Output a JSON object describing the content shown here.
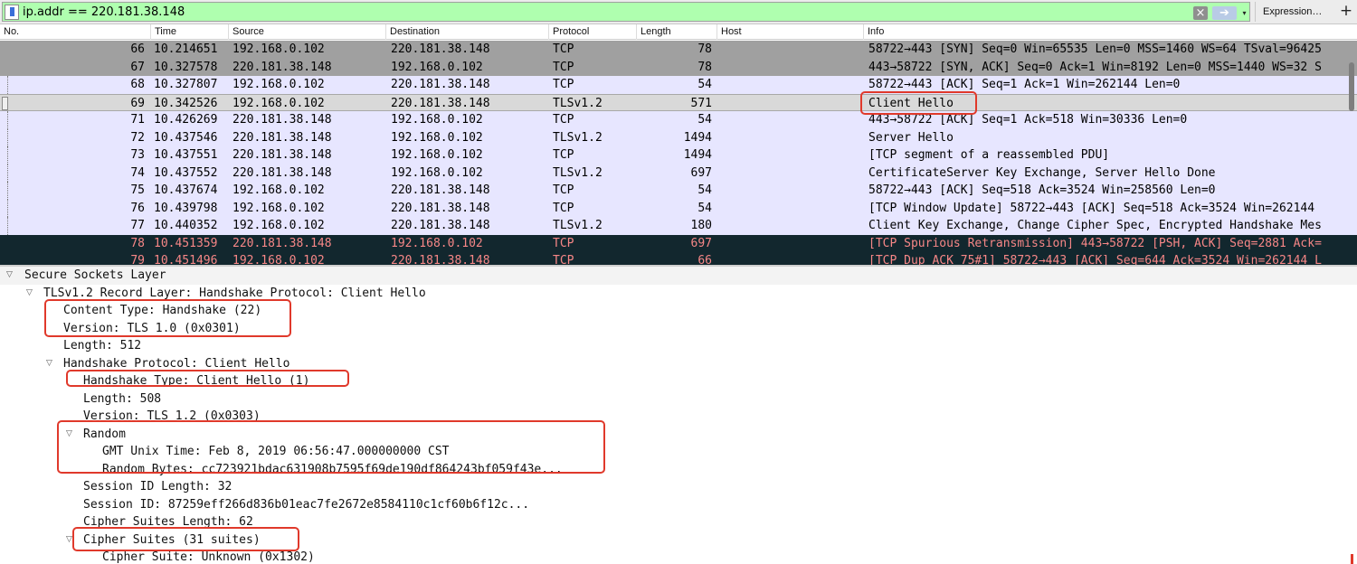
{
  "filter": {
    "value": "ip.addr == 220.181.38.148",
    "clear_icon": "×",
    "apply_icon": "➔",
    "dropdown_icon": "▾",
    "expression_label": "Expression…",
    "plus_label": "+"
  },
  "columns": [
    "No.",
    "Time",
    "Source",
    "Destination",
    "Protocol",
    "Length",
    "Host",
    "Info"
  ],
  "packets": [
    {
      "no": "66",
      "time": "10.214651",
      "src": "192.168.0.102",
      "dst": "220.181.38.148",
      "proto": "TCP",
      "len": "78",
      "info": "58722→443 [SYN] Seq=0 Win=65535 Len=0 MSS=1460 WS=64 TSval=96425"
    },
    {
      "no": "67",
      "time": "10.327578",
      "src": "220.181.38.148",
      "dst": "192.168.0.102",
      "proto": "TCP",
      "len": "78",
      "info": "443→58722 [SYN, ACK] Seq=0 Ack=1 Win=8192 Len=0 MSS=1440 WS=32 S"
    },
    {
      "no": "68",
      "time": "10.327807",
      "src": "192.168.0.102",
      "dst": "220.181.38.148",
      "proto": "TCP",
      "len": "54",
      "info": "58722→443 [ACK] Seq=1 Ack=1 Win=262144 Len=0"
    },
    {
      "no": "69",
      "time": "10.342526",
      "src": "192.168.0.102",
      "dst": "220.181.38.148",
      "proto": "TLSv1.2",
      "len": "571",
      "info": "Client Hello"
    },
    {
      "no": "71",
      "time": "10.426269",
      "src": "220.181.38.148",
      "dst": "192.168.0.102",
      "proto": "TCP",
      "len": "54",
      "info": "443→58722 [ACK] Seq=1 Ack=518 Win=30336 Len=0"
    },
    {
      "no": "72",
      "time": "10.437546",
      "src": "220.181.38.148",
      "dst": "192.168.0.102",
      "proto": "TLSv1.2",
      "len": "1494",
      "info": "Server Hello"
    },
    {
      "no": "73",
      "time": "10.437551",
      "src": "220.181.38.148",
      "dst": "192.168.0.102",
      "proto": "TCP",
      "len": "1494",
      "info": "[TCP segment of a reassembled PDU]"
    },
    {
      "no": "74",
      "time": "10.437552",
      "src": "220.181.38.148",
      "dst": "192.168.0.102",
      "proto": "TLSv1.2",
      "len": "697",
      "info": "CertificateServer Key Exchange, Server Hello Done"
    },
    {
      "no": "75",
      "time": "10.437674",
      "src": "192.168.0.102",
      "dst": "220.181.38.148",
      "proto": "TCP",
      "len": "54",
      "info": "58722→443 [ACK] Seq=518 Ack=3524 Win=258560 Len=0"
    },
    {
      "no": "76",
      "time": "10.439798",
      "src": "192.168.0.102",
      "dst": "220.181.38.148",
      "proto": "TCP",
      "len": "54",
      "info": "[TCP Window Update] 58722→443 [ACK] Seq=518 Ack=3524 Win=262144"
    },
    {
      "no": "77",
      "time": "10.440352",
      "src": "192.168.0.102",
      "dst": "220.181.38.148",
      "proto": "TLSv1.2",
      "len": "180",
      "info": "Client Key Exchange, Change Cipher Spec, Encrypted Handshake Mes"
    },
    {
      "no": "78",
      "time": "10.451359",
      "src": "220.181.38.148",
      "dst": "192.168.0.102",
      "proto": "TCP",
      "len": "697",
      "info": "[TCP Spurious Retransmission] 443→58722 [PSH, ACK] Seq=2881 Ack="
    },
    {
      "no": "79",
      "time": "10.451496",
      "src": "192.168.0.102",
      "dst": "220.181.38.148",
      "proto": "TCP",
      "len": "66",
      "info": "[TCP Dup ACK 75#1] 58722→443 [ACK] Seq=644 Ack=3524 Win=262144 L"
    }
  ],
  "details": {
    "expanded_icon": "▽",
    "ssl": "Secure Sockets Layer",
    "record_layer": "TLSv1.2 Record Layer: Handshake Protocol: Client Hello",
    "content_type": "Content Type: Handshake (22)",
    "version": "Version: TLS 1.0 (0x0301)",
    "length": "Length: 512",
    "handshake_protocol": "Handshake Protocol: Client Hello",
    "handshake_type": "Handshake Type: Client Hello (1)",
    "hs_length": "Length: 508",
    "hs_version": "Version: TLS 1.2 (0x0303)",
    "random": "Random",
    "gmt_time": "GMT Unix Time: Feb  8, 2019 06:56:47.000000000 CST",
    "random_bytes": "Random Bytes: cc723921bdac631908b7595f69de190df864243bf059f43e...",
    "session_id_length": "Session ID Length: 32",
    "session_id": "Session ID: 87259eff266d836b01eac7fe2672e8584110c1cf60b6f12c...",
    "cipher_suites_length": "Cipher Suites Length: 62",
    "cipher_suites": "Cipher Suites (31 suites)",
    "cipher_suite_first": "Cipher Suite: Unknown (0x1302)"
  }
}
